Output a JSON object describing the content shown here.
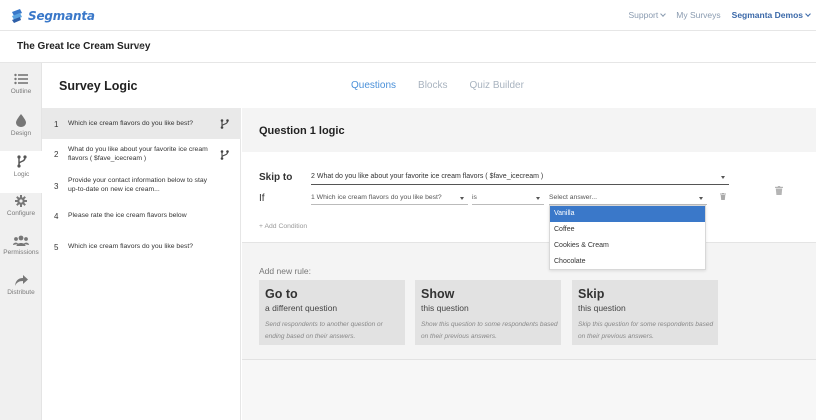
{
  "nav": {
    "logo_text": "Segmanta",
    "support": "Support",
    "my_surveys": "My Surveys",
    "account": "Segmanta Demos"
  },
  "survey": {
    "title": "The Great Ice Cream Survey"
  },
  "sidebar": {
    "items": [
      {
        "label": "Outline",
        "icon": "list-icon"
      },
      {
        "label": "Design",
        "icon": "droplet-icon"
      },
      {
        "label": "Logic",
        "icon": "branch-icon"
      },
      {
        "label": "Configure",
        "icon": "gear-icon"
      },
      {
        "label": "Permissions",
        "icon": "users-icon"
      },
      {
        "label": "Distribute",
        "icon": "share-icon"
      }
    ],
    "active": "Logic"
  },
  "page": {
    "title": "Survey Logic",
    "tabs": [
      "Questions",
      "Blocks",
      "Quiz Builder"
    ],
    "active_tab": "Questions"
  },
  "questions": [
    {
      "num": "1",
      "text": "Which ice cream flavors do you like best?"
    },
    {
      "num": "2",
      "text": "What do you like about your favorite ice cream flavors ( $fave_icecream )"
    },
    {
      "num": "3",
      "text": "Provide your contact information below to stay up-to-date on new ice cream..."
    },
    {
      "num": "4",
      "text": "Please rate the ice cream flavors below"
    },
    {
      "num": "5",
      "text": "Which ice cream flavors do you like best?"
    }
  ],
  "logic": {
    "title": "Question 1 logic",
    "skip_label": "Skip to",
    "skip_value": "2  What do you like about your favorite ice cream flavors ( $fave_icecream )",
    "if_label": "If",
    "cond_question": "1  Which ice cream flavors do you like best?",
    "cond_operator": "is",
    "cond_answer_placeholder": "Select answer...",
    "add_condition": "+ Add Condition",
    "answer_options": [
      "Vanilla",
      "Coffee",
      "Cookies & Cream",
      "Chocolate"
    ],
    "selected_option": "Vanilla"
  },
  "rules": {
    "heading": "Add new rule:",
    "cards": [
      {
        "main": "Go to",
        "sub": "a different question",
        "desc": "Send respondents to another question or ending based on their answers."
      },
      {
        "main": "Show",
        "sub": "this question",
        "desc": "Show this question to some respondents based on their previous answers."
      },
      {
        "main": "Skip",
        "sub": "this question",
        "desc": "Skip this question for some respondents based on their previous answers."
      }
    ]
  },
  "colors": {
    "accent": "#3a78c9",
    "tab_active": "#4a90d9"
  }
}
